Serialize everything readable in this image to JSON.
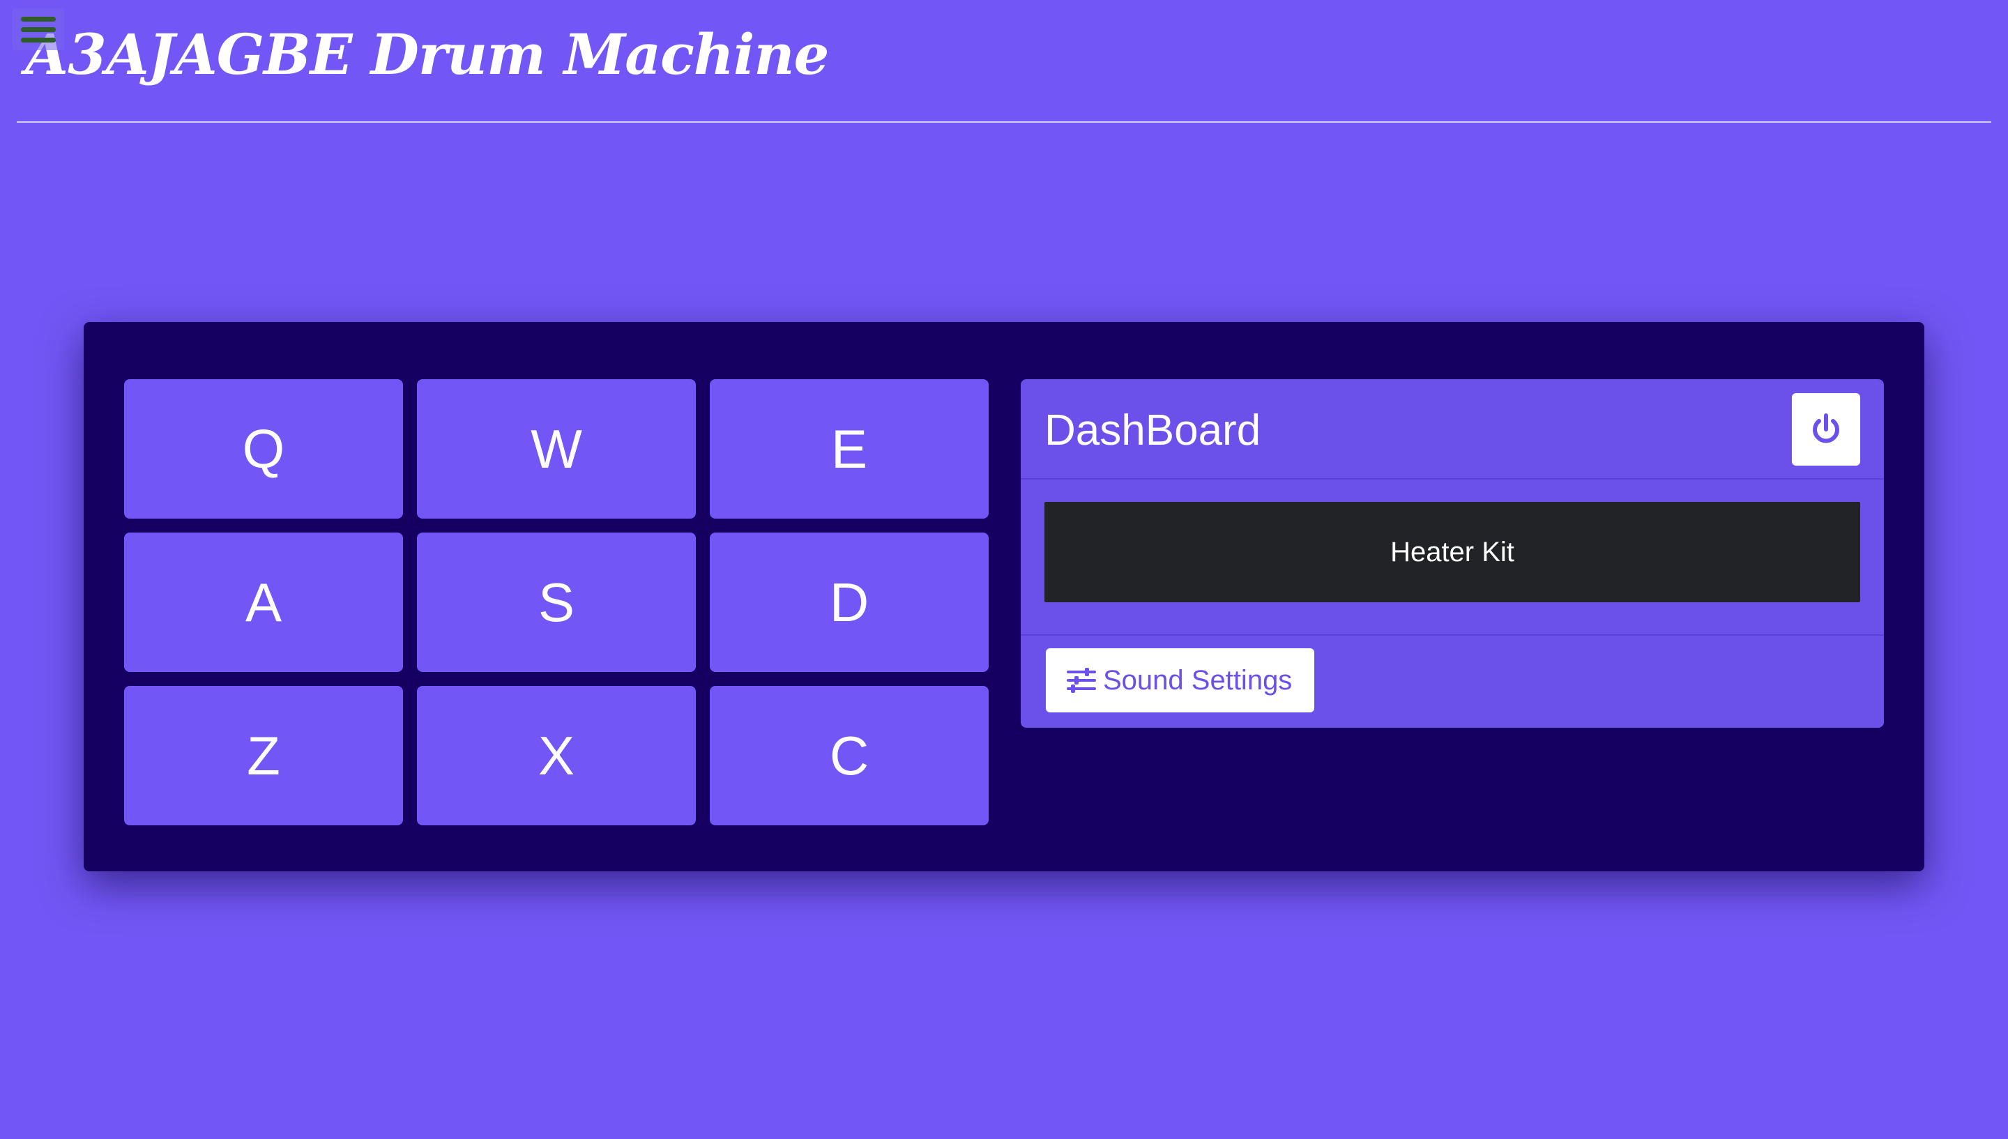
{
  "app": {
    "title": "A3AJAGBE Drum Machine"
  },
  "nav": {
    "menu_icon": "hamburger-menu-icon"
  },
  "pads": [
    {
      "key": "Q"
    },
    {
      "key": "W"
    },
    {
      "key": "E"
    },
    {
      "key": "A"
    },
    {
      "key": "S"
    },
    {
      "key": "D"
    },
    {
      "key": "Z"
    },
    {
      "key": "X"
    },
    {
      "key": "C"
    }
  ],
  "dashboard": {
    "title": "DashBoard",
    "power_icon": "power-icon",
    "display_text": "Heater Kit",
    "settings_icon": "sliders-icon",
    "settings_label": "Sound Settings"
  },
  "colors": {
    "background": "#7357f6",
    "machine": "#150062",
    "pad": "#7357f6",
    "dashboard": "#6b50ea",
    "display": "#222326",
    "accent": "#6b50ea"
  }
}
